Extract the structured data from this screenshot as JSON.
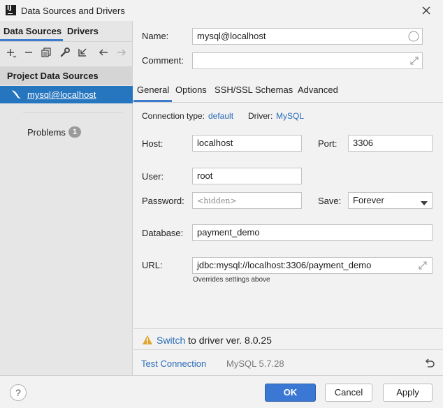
{
  "window": {
    "title": "Data Sources and Drivers",
    "logo_text": "IJ"
  },
  "left": {
    "tabs": [
      "Data Sources",
      "Drivers"
    ],
    "section_title": "Project Data Sources",
    "items": [
      {
        "label": "mysql@localhost"
      }
    ],
    "problems": {
      "label": "Problems",
      "count": "1"
    }
  },
  "form": {
    "name_label": "Name:",
    "name_value": "mysql@localhost",
    "comment_label": "Comment:",
    "comment_value": ""
  },
  "tabs": [
    "General",
    "Options",
    "SSH/SSL",
    "Schemas",
    "Advanced"
  ],
  "general": {
    "connection_type_label": "Connection type:",
    "connection_type_value": "default",
    "driver_label": "Driver:",
    "driver_value": "MySQL",
    "host_label": "Host:",
    "host_value": "localhost",
    "port_label": "Port:",
    "port_value": "3306",
    "user_label": "User:",
    "user_value": "root",
    "password_label": "Password:",
    "password_placeholder": "<hidden>",
    "save_label": "Save:",
    "save_value": "Forever",
    "database_label": "Database:",
    "database_value": "payment_demo",
    "url_label": "URL:",
    "url_value": "jdbc:mysql://localhost:3306/payment_demo",
    "url_hint": "Overrides settings above"
  },
  "warning": {
    "link": "Switch",
    "text": "to driver ver. 8.0.25"
  },
  "status": {
    "test_connection": "Test Connection",
    "server_version": "MySQL 5.7.28"
  },
  "footer": {
    "help": "?",
    "ok": "OK",
    "cancel": "Cancel",
    "apply": "Apply"
  },
  "colors": {
    "accent": "#3d7ccd",
    "selection": "#2675bf",
    "link": "#2a6cb8",
    "ok_button": "#3b78d3",
    "warning": "#e0a531"
  }
}
